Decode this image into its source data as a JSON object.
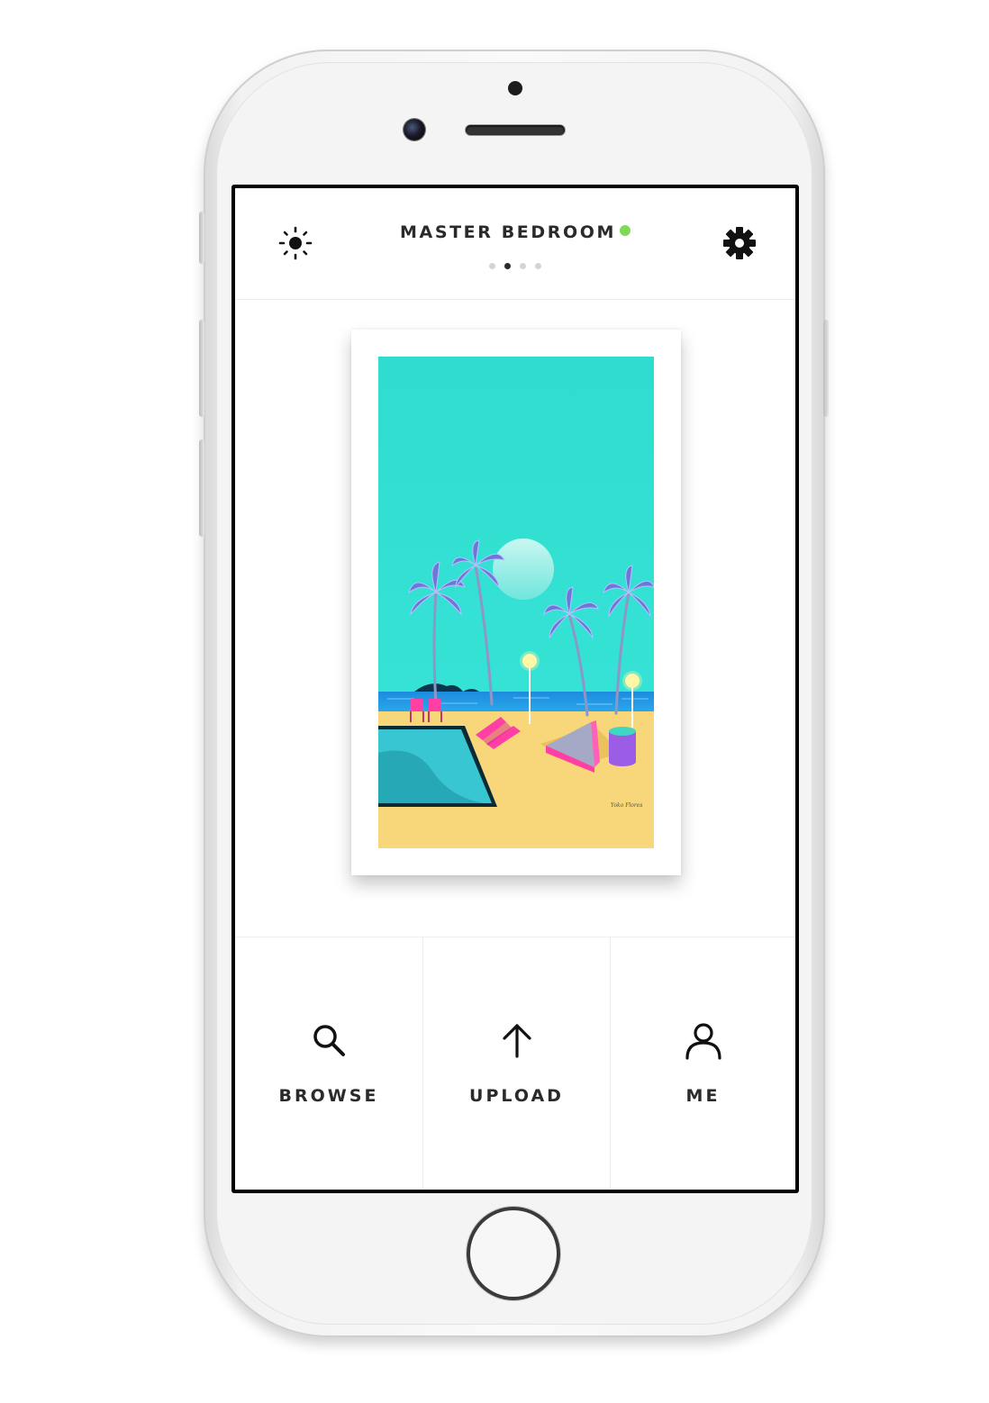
{
  "header": {
    "title": "MASTER BEDROOM",
    "connection_status_color": "#7ed957",
    "pages_total": 4,
    "page_active_index": 1,
    "left_icon": "brightness-icon",
    "right_icon": "gear-icon"
  },
  "artwork": {
    "signature": "Yoko Flores",
    "colors": {
      "sky": "#34e0d4",
      "sand": "#f8d77a",
      "sea": "#1e8fe0",
      "accent": "#ff3fa4"
    }
  },
  "bottom_nav": {
    "browse": {
      "label": "BROWSE",
      "icon": "search-icon"
    },
    "upload": {
      "label": "UPLOAD",
      "icon": "arrow-up-icon"
    },
    "me": {
      "label": "ME",
      "icon": "person-icon"
    }
  }
}
